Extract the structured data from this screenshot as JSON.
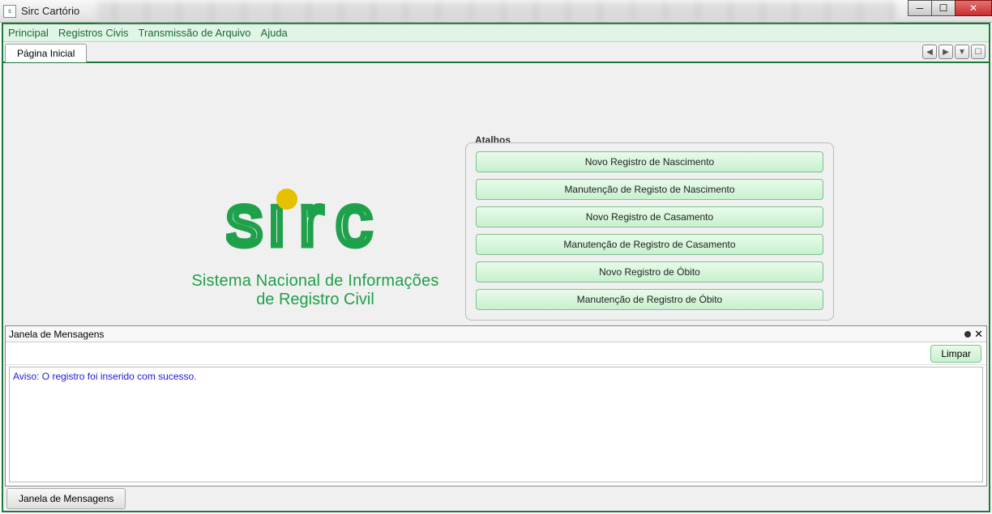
{
  "window": {
    "title": "Sirc Cartório"
  },
  "menu": {
    "principal": "Principal",
    "registros": "Registros Civis",
    "transmissao": "Transmissão de Arquivo",
    "ajuda": "Ajuda"
  },
  "tab": {
    "pagina_inicial": "Página Inicial"
  },
  "logo": {
    "line1": "Sistema Nacional de Informações",
    "line2": "de Registro Civil"
  },
  "shortcuts": {
    "label": "Atalhos",
    "items": [
      "Novo Registro de Nascimento",
      "Manutenção de Registo de Nascimento",
      "Novo Registro de Casamento",
      "Manutenção de Registro de Casamento",
      "Novo Registro de Óbito",
      "Manutenção de Registro de Óbito"
    ]
  },
  "messages": {
    "title": "Janela de Mensagens",
    "clear": "Limpar",
    "content": "Aviso: O registro foi inserido com sucesso.",
    "tab": "Janela de Mensagens"
  }
}
